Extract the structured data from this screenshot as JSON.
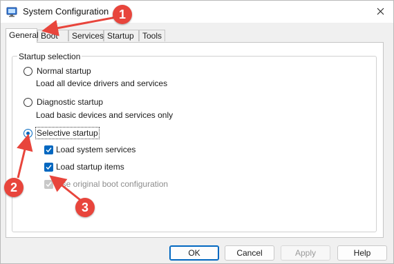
{
  "window": {
    "title": "System Configuration"
  },
  "tabs": [
    {
      "label": "General"
    },
    {
      "label": "Boot"
    },
    {
      "label": "Services"
    },
    {
      "label": "Startup"
    },
    {
      "label": "Tools"
    }
  ],
  "startup_selection": {
    "group_title": "Startup selection",
    "options": [
      {
        "label": "Normal startup",
        "description": "Load all device drivers and services",
        "selected": false
      },
      {
        "label": "Diagnostic startup",
        "description": "Load basic devices and services only",
        "selected": false
      },
      {
        "label": "Selective startup",
        "selected": true
      }
    ],
    "checkboxes": [
      {
        "label": "Load system services",
        "checked": true,
        "enabled": true
      },
      {
        "label": "Load startup items",
        "checked": true,
        "enabled": true
      },
      {
        "label": "Use original boot configuration",
        "checked": true,
        "enabled": false
      }
    ]
  },
  "buttons": {
    "ok": "OK",
    "cancel": "Cancel",
    "apply": "Apply",
    "help": "Help"
  },
  "annotations": {
    "callout_1": "1",
    "callout_2": "2",
    "callout_3": "3",
    "color": "#e8453c"
  },
  "colors": {
    "accent": "#0067c0"
  }
}
